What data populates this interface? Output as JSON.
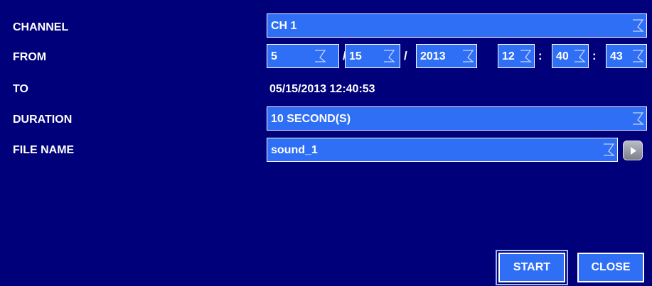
{
  "form": {
    "channel": {
      "label": "CHANNEL",
      "value": "CH 1"
    },
    "from": {
      "label": "FROM",
      "month": "5",
      "day": "15",
      "year": "2013",
      "hour": "12",
      "minute": "40",
      "second": "43",
      "date_separator": "/",
      "time_separator": ":"
    },
    "to": {
      "label": "TO",
      "value": "05/15/2013 12:40:53"
    },
    "duration": {
      "label": "DURATION",
      "value": "10 SECOND(S)"
    },
    "file_name": {
      "label": "FILE NAME",
      "value": "sound_1"
    }
  },
  "buttons": {
    "start": "START",
    "close": "CLOSE"
  },
  "icons": {
    "dropdown": "dropdown-arrow-icon",
    "play": "play-icon"
  },
  "colors": {
    "background": "#00007a",
    "field": "#2e6ff5",
    "text": "#ffffff"
  }
}
